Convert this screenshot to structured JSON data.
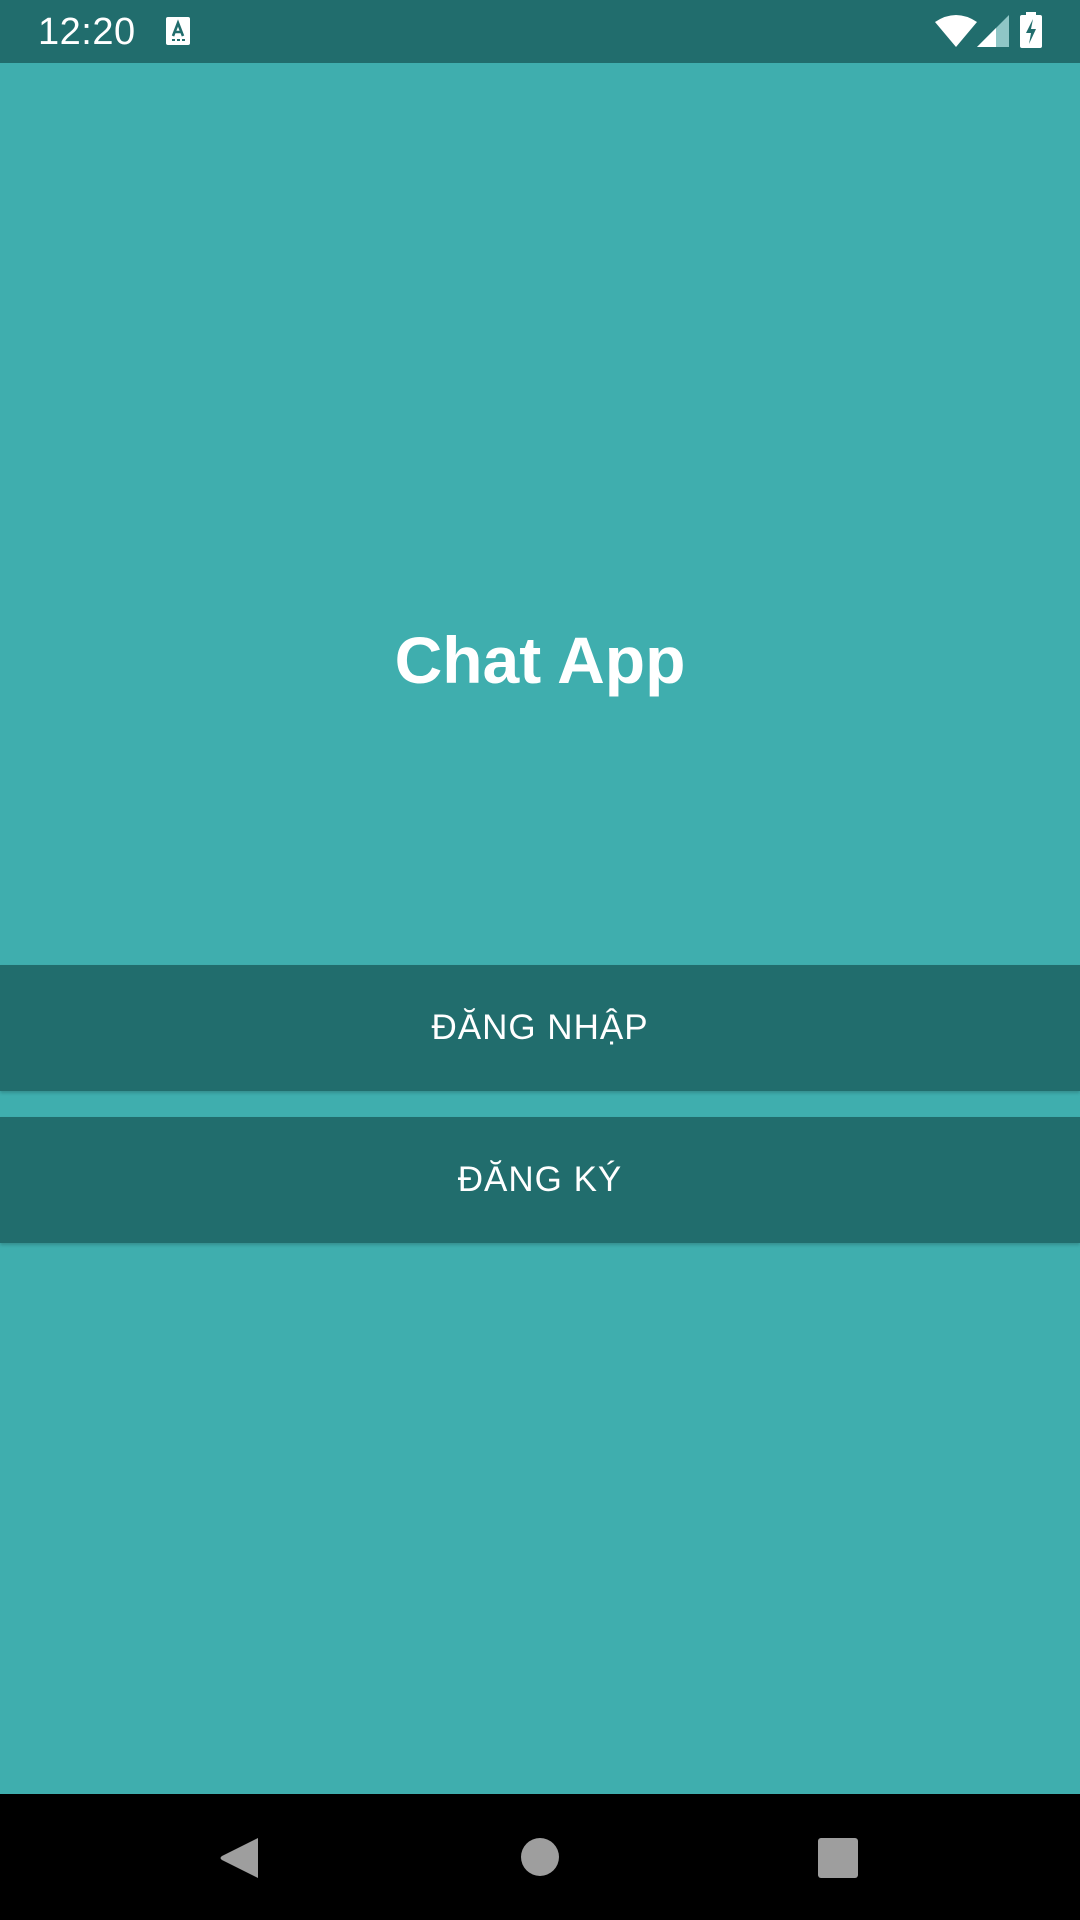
{
  "status_bar": {
    "time": "12:20",
    "notification_icon": "keyboard-a-icon",
    "wifi_icon": "wifi-icon",
    "signal_icon": "cell-signal-icon",
    "battery_icon": "battery-charging-icon"
  },
  "main": {
    "title": "Chat App",
    "login_label": "ĐĂNG NHẬP",
    "register_label": "ĐĂNG KÝ"
  },
  "nav_bar": {
    "back_icon": "back-triangle-icon",
    "home_icon": "home-circle-icon",
    "recents_icon": "recents-square-icon"
  },
  "colors": {
    "background": "#3faeae",
    "bar_dark": "#216d6d",
    "nav_background": "#000000",
    "text": "#ffffff",
    "nav_icon": "#9e9e9e"
  }
}
